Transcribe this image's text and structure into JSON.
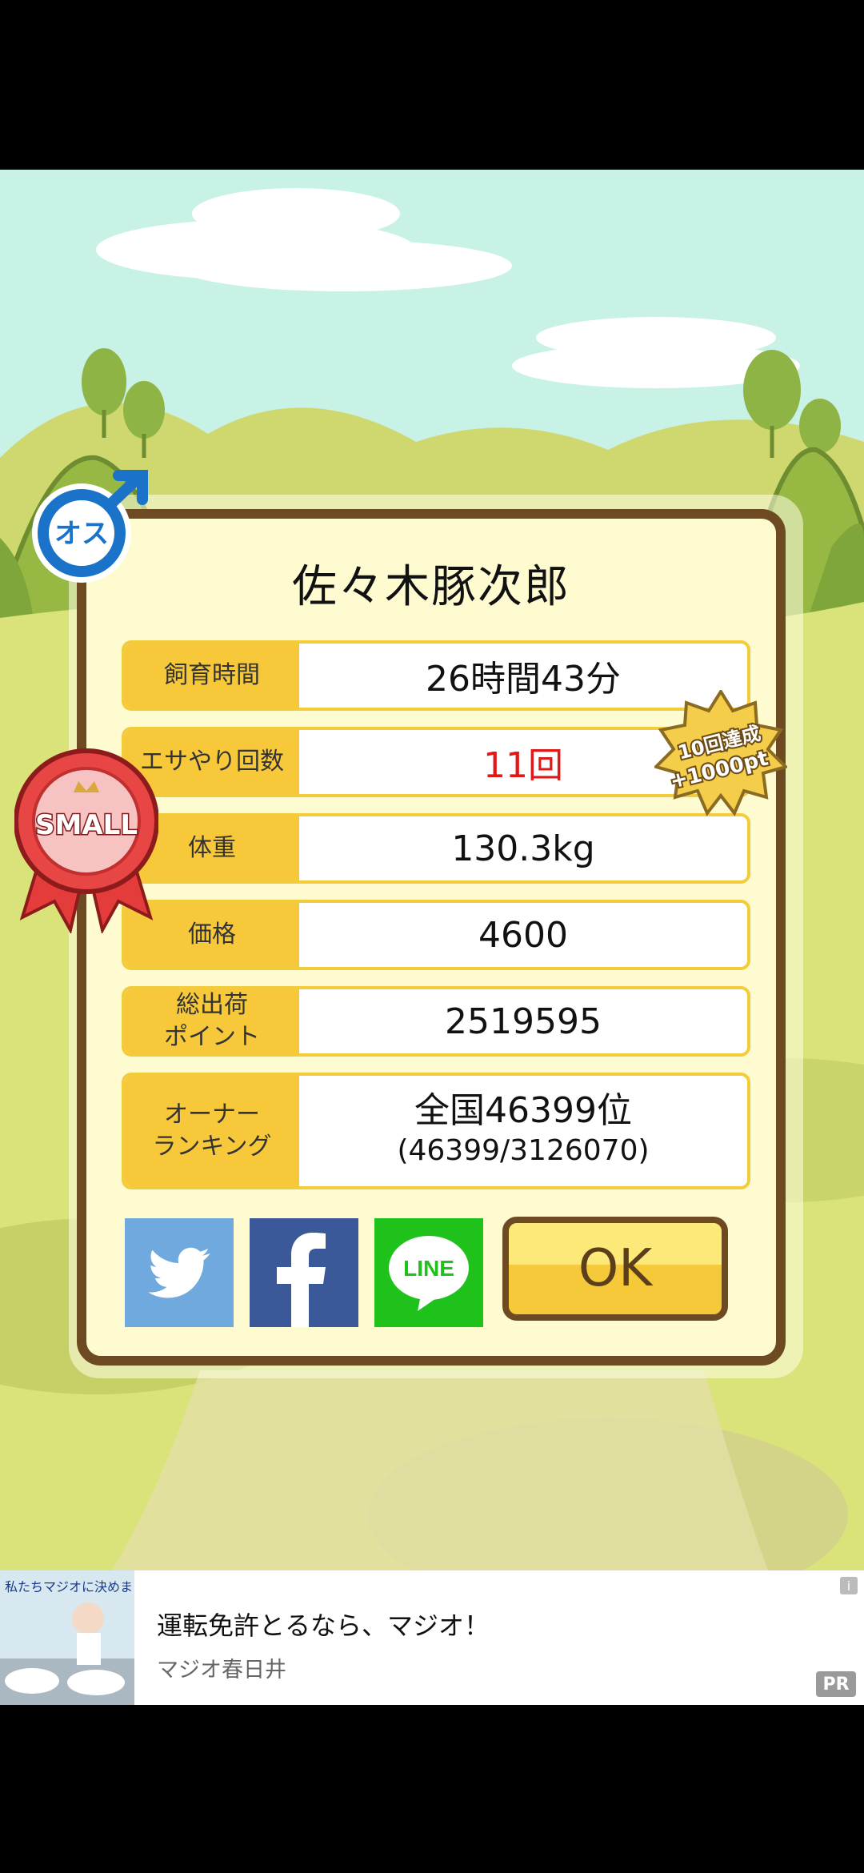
{
  "card": {
    "name": "佐々木豚次郎",
    "gender_badge": "オス",
    "size_badge": "SMALL",
    "achievement_badge": {
      "line1": "10回達成",
      "line2": "+1000pt"
    },
    "rows": [
      {
        "label": "飼育時間",
        "value": "26時間43分"
      },
      {
        "label": "エサやり回数",
        "value": "11回"
      },
      {
        "label": "体重",
        "value": "130.3kg"
      },
      {
        "label": "価格",
        "value": "4600"
      },
      {
        "label": "総出荷\nポイント",
        "value": "2519595"
      },
      {
        "label": "オーナー\nランキング",
        "value": "全国46399位",
        "value2": "(46399/3126070)"
      }
    ],
    "share": {
      "twitter_icon": "twitter-bird-icon",
      "facebook_label": "f",
      "line_label": "LINE"
    },
    "ok_label": "OK"
  },
  "ad": {
    "image_text": "私たちマジオに決めました!",
    "title": "運転免許とるなら、マジオ！",
    "advertiser": "マジオ春日井",
    "pr_label": "PR",
    "info_label": "i"
  },
  "colors": {
    "sky": "#c9f2e6",
    "card_border": "#6e4a22",
    "label_bg": "#f7c93a",
    "accent_red": "#e01818",
    "twitter": "#6fa9de",
    "facebook": "#3b5998",
    "line": "#1fc11b"
  }
}
